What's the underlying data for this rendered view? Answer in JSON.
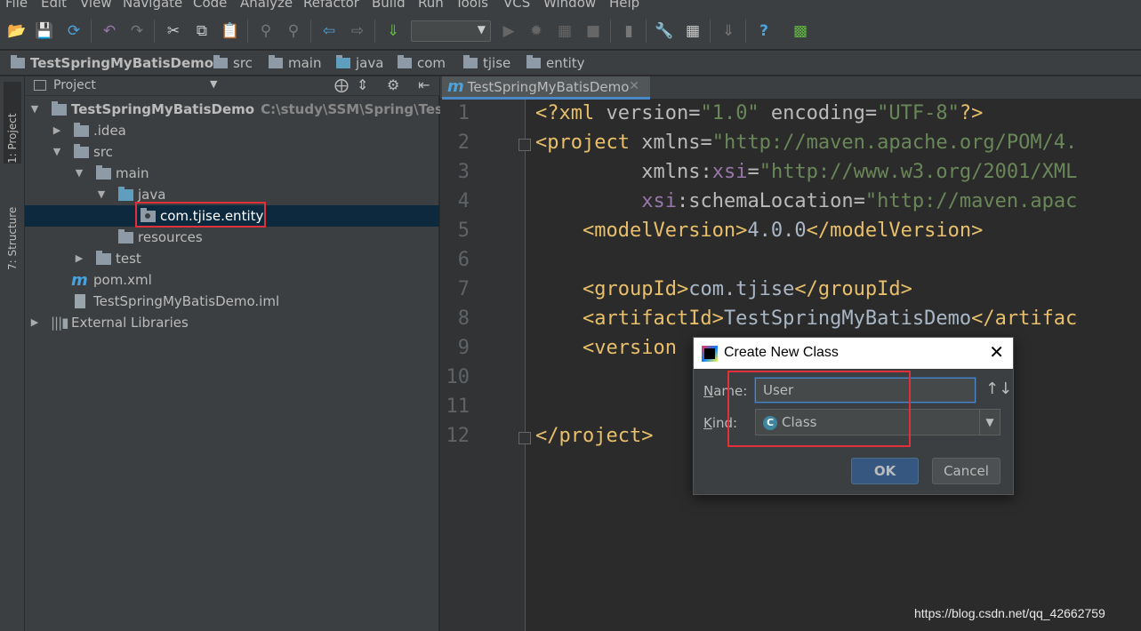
{
  "menu": [
    "File",
    "Edit",
    "View",
    "Navigate",
    "Code",
    "Analyze",
    "Refactor",
    "Build",
    "Run",
    "Tools",
    "VCS",
    "Window",
    "Help"
  ],
  "toolbar": {
    "icons": [
      "open-folder-icon",
      "save-icon",
      "sync-icon",
      "undo-icon",
      "redo-icon",
      "cut-icon",
      "copy-icon",
      "paste-icon",
      "find-icon",
      "replace-icon",
      "back-icon",
      "forward-icon",
      "make-project-icon",
      "run-icon",
      "debug-icon",
      "coverage-icon",
      "stop-icon",
      "attach-icon",
      "settings-icon",
      "project-structure-icon",
      "vcs-icon",
      "help-icon",
      "terminal-icon"
    ],
    "run_config_value": ""
  },
  "breadcrumb": [
    "TestSpringMyBatisDemo",
    "src",
    "main",
    "java",
    "com",
    "tjise",
    "entity"
  ],
  "left_strip": {
    "project_tab": "1: Project",
    "structure_tab": "7: Structure"
  },
  "project_panel": {
    "title": "Project",
    "tree": {
      "root_name": "TestSpringMyBatisDemo",
      "root_path": "C:\\study\\SSM\\Spring\\TestSpri",
      "idea": ".idea",
      "src": "src",
      "main": "main",
      "java": "java",
      "package": "com.tjise.entity",
      "resources": "resources",
      "test": "test",
      "pom": "pom.xml",
      "iml": "TestSpringMyBatisDemo.iml",
      "ext_libs": "External Libraries"
    }
  },
  "editor": {
    "tab_label": "TestSpringMyBatisDemo",
    "line_numbers": [
      "1",
      "2",
      "3",
      "4",
      "5",
      "6",
      "7",
      "8",
      "9",
      "10",
      "11",
      "12"
    ],
    "code": {
      "l1_open": "<?xml ",
      "l1_attr1": "version",
      "l1_eq1": "=",
      "l1_val1": "\"1.0\"",
      "l1_attr2": " encoding",
      "l1_eq2": "=",
      "l1_val2": "\"UTF-8\"",
      "l1_close": "?>",
      "l2_tag": "<project ",
      "l2_attr": "xmlns",
      "l2_eq": "=",
      "l2_val": "\"http://maven.apache.org/POM/4.",
      "l3_indent": "         ",
      "l3_attr": "xmlns:",
      "l3_ns": "xsi",
      "l3_eq": "=",
      "l3_val": "\"http://www.w3.org/2001/XML",
      "l4_indent": "         ",
      "l4_ns": "xsi",
      "l4_attr": ":schemaLocation",
      "l4_eq": "=",
      "l4_val": "\"http://maven.apac",
      "l5_indent": "    ",
      "l5_open": "<modelVersion>",
      "l5_text": "4.0.0",
      "l5_close": "</modelVersion>",
      "l7_indent": "    ",
      "l7_open": "<groupId>",
      "l7_text": "com.tjise",
      "l7_close": "</groupId>",
      "l8_indent": "    ",
      "l8_open": "<artifactId>",
      "l8_text": "TestSpringMyBatisDemo",
      "l8_close": "</artifac",
      "l9_indent": "    ",
      "l9_open": "<version",
      "l12": "</project>"
    }
  },
  "dialog": {
    "title": "Create New Class",
    "name_label_u": "N",
    "name_label_rest": "ame:",
    "name_value": "User",
    "kind_label_u": "K",
    "kind_label_rest": "ind:",
    "kind_value": "Class",
    "kind_icon_letter": "C",
    "ok_label": "OK",
    "cancel_label": "Cancel"
  },
  "watermark": "https://blog.csdn.net/qq_42662759",
  "colors": {
    "highlight_box": "#e0313b",
    "selection": "#0d293e",
    "accent": "#4a88c7"
  }
}
